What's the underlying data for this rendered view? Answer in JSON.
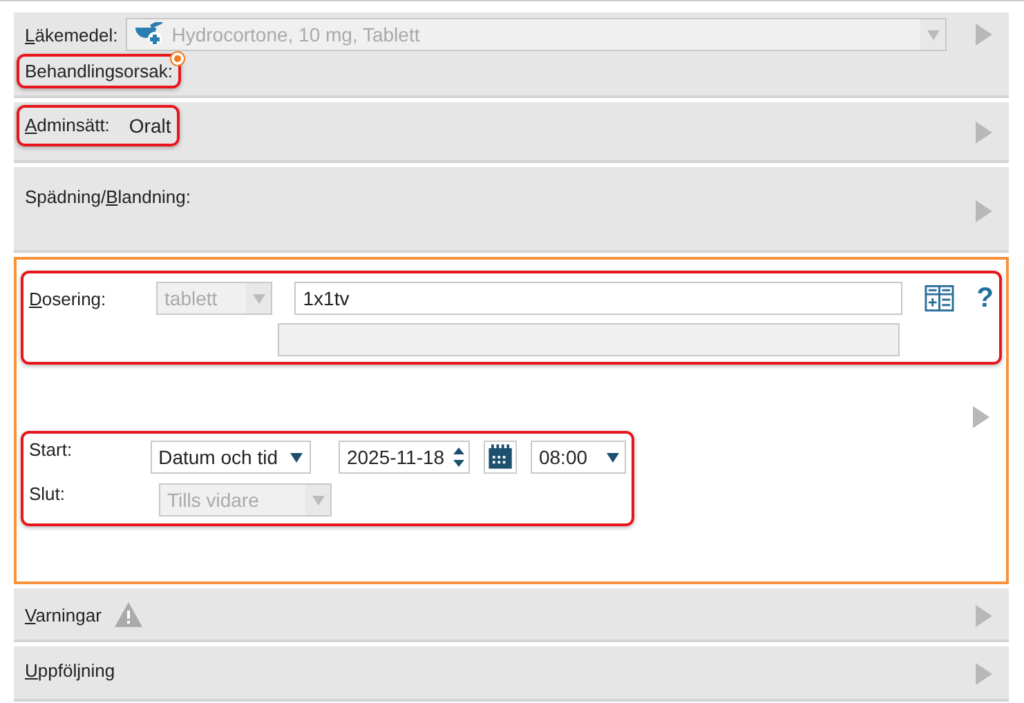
{
  "medication": {
    "label": {
      "key": "L",
      "rest": "äkemedel:"
    },
    "value": "Hydrocortone, 10 mg, Tablett",
    "disabled": true
  },
  "reason": {
    "label": "Behandlingsorsak:",
    "required": true,
    "highlighted": true
  },
  "route": {
    "label": {
      "key": "A",
      "rest": "dminsätt:"
    },
    "value": "Oralt",
    "highlighted": true
  },
  "dilution": {
    "label": {
      "before": "Spädning/",
      "key": "B",
      "rest": "landning:"
    }
  },
  "dosing": {
    "active": true,
    "label": {
      "key": "D",
      "rest": "osering:"
    },
    "unit": "tablett",
    "unit_disabled": true,
    "value": "1x1tv",
    "help": "?",
    "highlighted": true,
    "start": {
      "label": "Start:",
      "mode": "Datum och tid",
      "date": "2025-11-18",
      "time": "08:00"
    },
    "end": {
      "label": "Slut:",
      "mode": "Tills vidare",
      "disabled": true
    },
    "schedule_highlighted": true
  },
  "sections": [
    {
      "label": {
        "key": "V",
        "rest": "arningar"
      },
      "warning": true
    },
    {
      "label": {
        "key": "U",
        "rest": "ppföljning"
      },
      "warning": false
    }
  ]
}
